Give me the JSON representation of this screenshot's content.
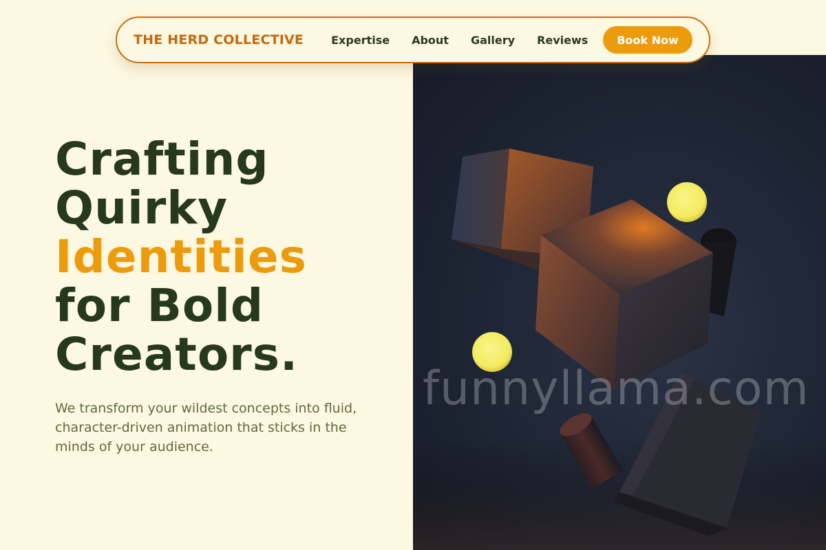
{
  "navbar": {
    "brand": "THE HERD COLLECTIVE",
    "links": [
      "Expertise",
      "About",
      "Gallery",
      "Reviews"
    ],
    "cta_label": "Book Now"
  },
  "hero": {
    "headline_lines": [
      "Crafting",
      "Quirky",
      "Identities",
      "for Bold",
      "Creators."
    ],
    "accent_line": "Identities",
    "subtext": "We transform your wildest concepts into fluid, character-driven animation that sticks in the minds of your audience.",
    "watermark": "funnyllama.com"
  },
  "colors": {
    "background": "#fdf8e1",
    "brand": "#c4690d",
    "accent": "#ec9b0c",
    "heading": "#27391c",
    "body_text": "#5d6a3e",
    "image_bg": "#1d2433"
  },
  "icons": {
    "hero_image": "abstract-3d-cubes-image"
  }
}
